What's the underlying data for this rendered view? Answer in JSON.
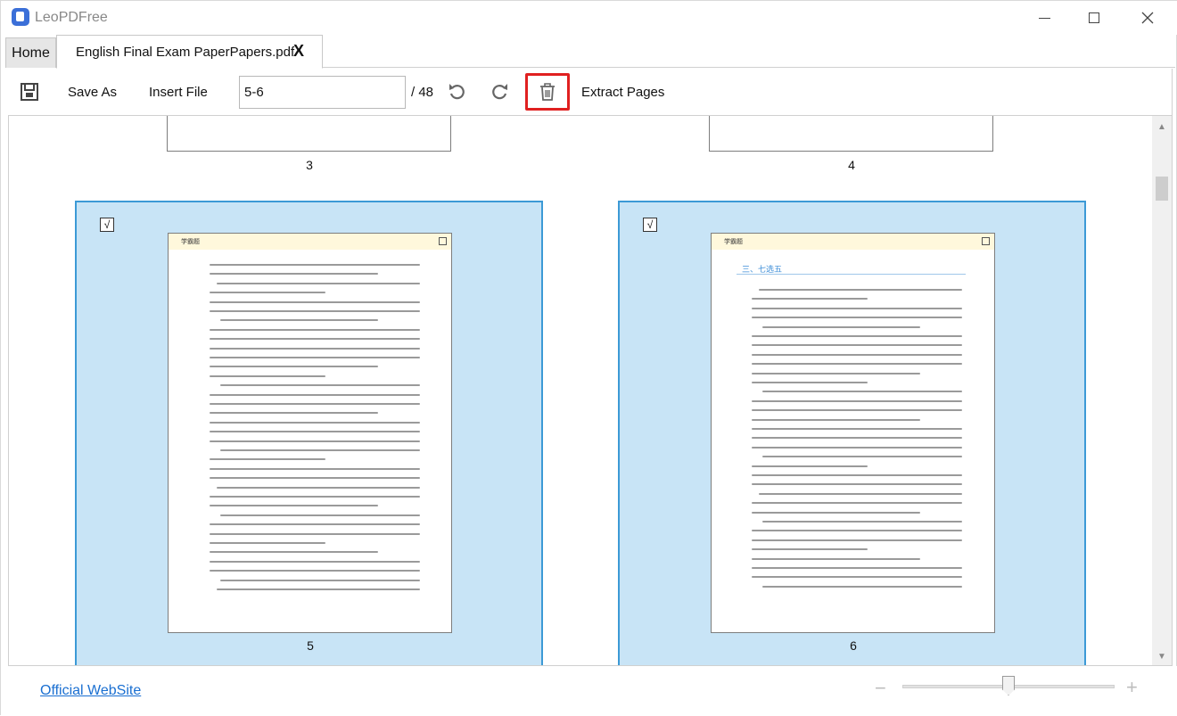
{
  "app": {
    "title": "LeoPDFree"
  },
  "tabs": {
    "home_label": "Home",
    "file_label": "English Final Exam PaperPapers.pdf",
    "close_label": "X"
  },
  "toolbar": {
    "save_as_label": "Save As",
    "insert_file_label": "Insert File",
    "page_range_value": "5-6",
    "total_pages_label": "/ 48",
    "extract_label": "Extract Pages"
  },
  "icons": {
    "save": "save-icon",
    "undo": "undo-icon",
    "redo": "redo-icon",
    "delete": "trash-icon",
    "highlight_color": "#e02020",
    "selection_color": "#3c9ad6",
    "selection_bg": "#c8e4f6"
  },
  "pages": [
    {
      "number": "3",
      "selected": false
    },
    {
      "number": "4",
      "selected": false
    },
    {
      "number": "5",
      "selected": true,
      "check_mark": "√",
      "header_label": "学霸题"
    },
    {
      "number": "6",
      "selected": true,
      "check_mark": "√",
      "header_label": "学霸题",
      "section_title": "三、七选五"
    }
  ],
  "footer": {
    "official_site_label": "Official WebSite",
    "zoom_minus": "−",
    "zoom_plus": "+",
    "zoom_level_fraction": 0.5
  }
}
